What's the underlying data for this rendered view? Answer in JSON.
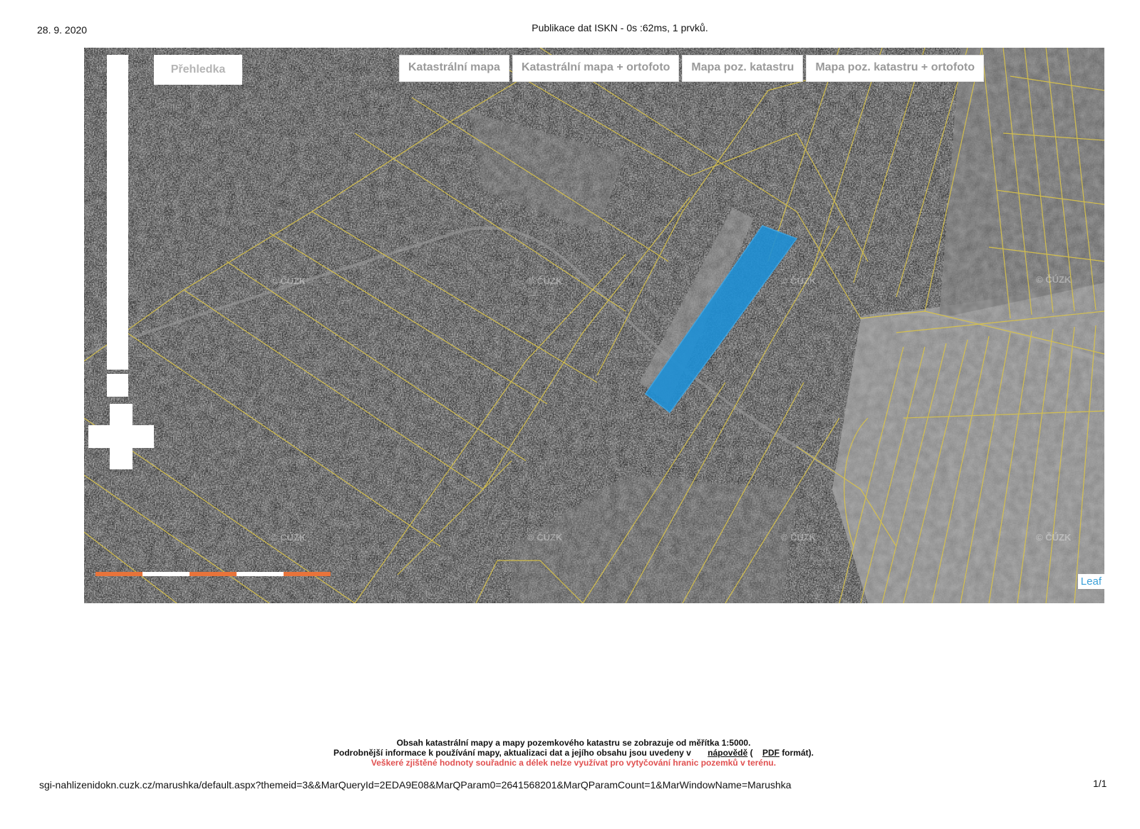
{
  "header": {
    "date": "28. 9. 2020",
    "title": "Publikace dat ISKN - 0s :62ms, 1 prvků."
  },
  "map": {
    "overview_label": "Přehledka",
    "layers": [
      {
        "label": "Katastrální mapa"
      },
      {
        "label": "Katastrální mapa + ortofoto"
      },
      {
        "label": "Mapa poz. katastru"
      },
      {
        "label": "Mapa poz. katastru + ortofoto"
      }
    ],
    "watermark": "© ČÚZK",
    "attribution": "Leaf",
    "colors": {
      "parcel_lines": "#d8c24a",
      "selected_parcel": "#1e90d6",
      "scale_orange": "#e8733a",
      "scale_white": "#ffffff"
    }
  },
  "notes": {
    "line1": "Obsah katastrální mapy a mapy pozemkového katastru se zobrazuje od měřítka 1:5000.",
    "line2_pre": "Podrobnější informace k používání mapy, aktualizaci dat a jejího obsahu jsou uvedeny v",
    "link_help": "nápovědě",
    "line2_mid": "(",
    "link_pdf": "PDF",
    "line2_post": "formát).",
    "warning": "Veškeré zjištěné hodnoty souřadnic a délek nelze využívat pro vytyčování hranic pozemků v terénu."
  },
  "footer": {
    "url": "sgi-nahlizenidokn.cuzk.cz/marushka/default.aspx?themeid=3&&MarQueryId=2EDA9E08&MarQParam0=2641568201&MarQParamCount=1&MarWindowName=Marushka",
    "page": "1/1"
  }
}
